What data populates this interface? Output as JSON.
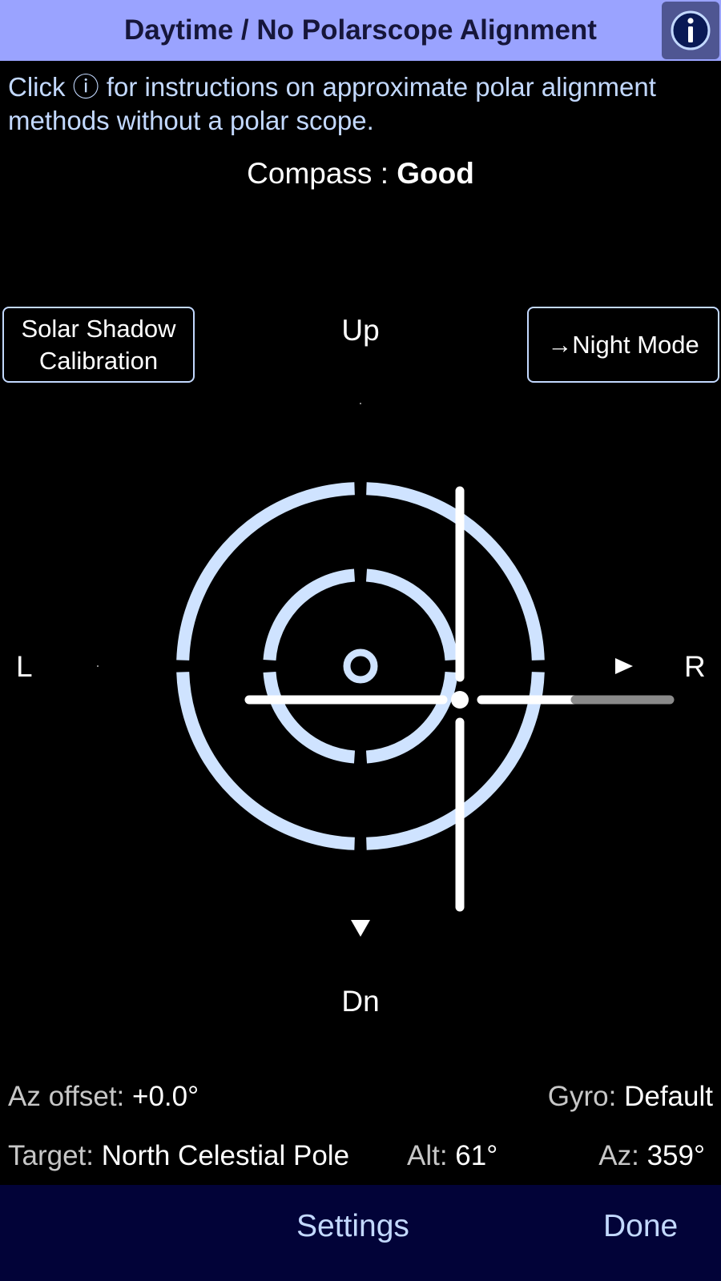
{
  "header": {
    "title": "Daytime / No Polarscope Alignment",
    "info_icon": "info-circle-icon"
  },
  "instructions": {
    "prefix": "Click ",
    "symbol": "ⓘ",
    "suffix": " for instructions on approximate polar alignment methods without a polar scope."
  },
  "compass": {
    "label": "Compass : ",
    "value": "Good"
  },
  "buttons": {
    "solar_shadow_line1": "Solar Shadow",
    "solar_shadow_line2": "Calibration",
    "night_mode": "→Night Mode"
  },
  "directions": {
    "up": "Up",
    "down": "Dn",
    "left": "L",
    "right": "R"
  },
  "status": {
    "az_offset_label": "Az offset: ",
    "az_offset_value": "+0.0°",
    "gyro_label": "Gyro: ",
    "gyro_value": "Default",
    "target_label": "Target: ",
    "target_value": "North Celestial Pole",
    "alt_label": "Alt: ",
    "alt_value": "61°",
    "az_label": "Az: ",
    "az_value": "359°"
  },
  "toolbar": {
    "settings": "Settings",
    "done": "Done"
  },
  "colors": {
    "title_bar": "#9aa3ff",
    "reticle": "#cfe3ff",
    "link": "#c3d9ff",
    "toolbar": "#020338"
  }
}
